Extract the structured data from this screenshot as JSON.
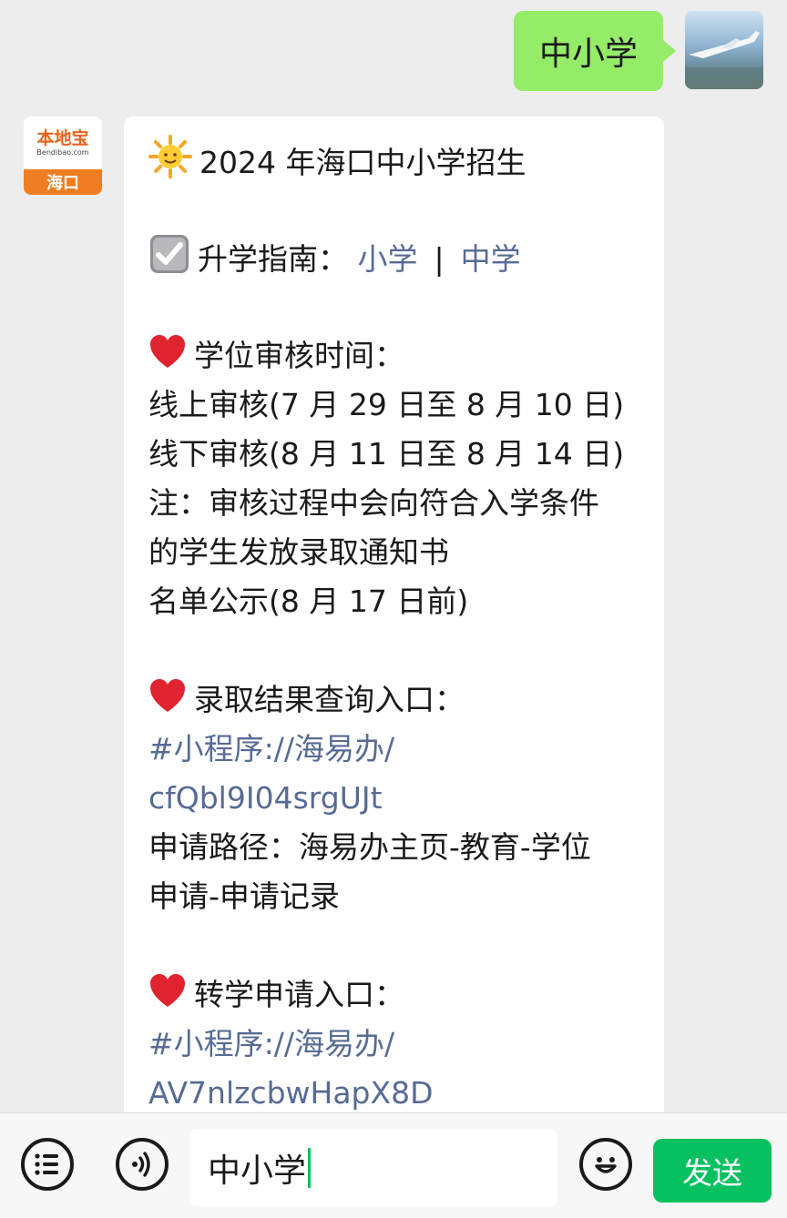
{
  "chat": {
    "outgoing": {
      "text": "中小学"
    },
    "incoming": {
      "avatar": {
        "brand_cn": "本地宝",
        "brand_en": "Bendibao.com",
        "city": "海口"
      },
      "title": "2024 年海口中小学招生",
      "guide": {
        "label": "升学指南：",
        "link_primary": "小学",
        "separator": "|",
        "link_middle": "中学"
      },
      "review": {
        "heading": "学位审核时间：",
        "online": "线上审核(7 月 29 日至 8 月 10 日)",
        "offline": "线下审核(8 月 11 日至 8 月 14 日)",
        "note_line1": "注：审核过程中会向符合入学条件",
        "note_line2": "的学生发放录取通知书",
        "publicity": "名单公示(8 月 17 日前)"
      },
      "result": {
        "heading": "录取结果查询入口：",
        "link_line1": "#小程序://海易办/",
        "link_line2": "cfQbl9I04srgUJt",
        "path_line1": "申请路径：海易办主页-教育-学位",
        "path_line2": "申请-申请记录"
      },
      "transfer": {
        "heading": "转学申请入口：",
        "link_line1": "#小程序://海易办/",
        "link_line2": "AV7nlzcbwHapX8D"
      }
    }
  },
  "input": {
    "value": "中小学",
    "send_label": "发送"
  },
  "icons": {
    "list": "list-icon",
    "voice": "voice-icon",
    "emoji": "emoji-icon",
    "sun": "sun-icon",
    "check": "checkbox-icon",
    "heart": "heart-icon"
  },
  "colors": {
    "bubble_out": "#95ec69",
    "link": "#576b95",
    "send": "#07c160",
    "heart": "#e0242f"
  }
}
